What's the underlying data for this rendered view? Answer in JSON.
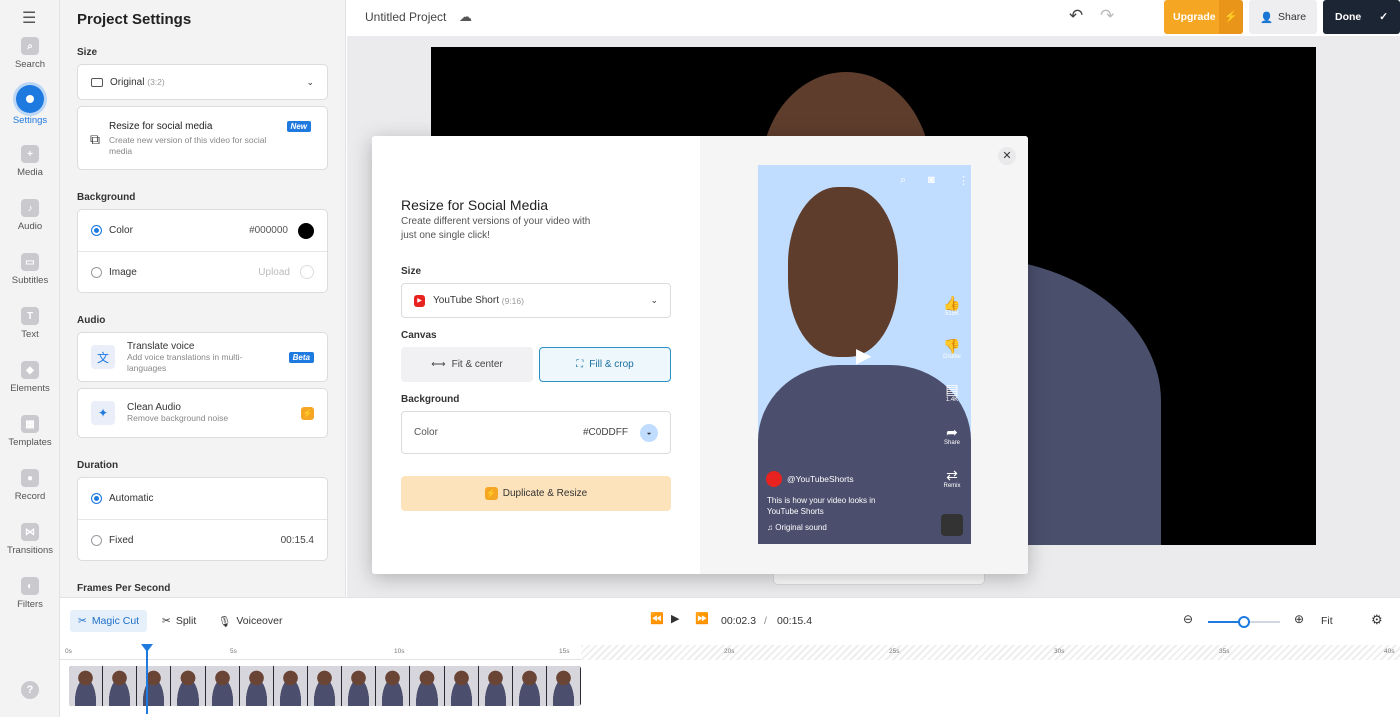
{
  "rail": {
    "items": [
      {
        "label": "Search",
        "icon": "search-icon"
      },
      {
        "label": "Settings",
        "icon": "settings-icon",
        "active": true
      },
      {
        "label": "Media",
        "icon": "media-icon"
      },
      {
        "label": "Audio",
        "icon": "audio-icon"
      },
      {
        "label": "Subtitles",
        "icon": "subtitles-icon"
      },
      {
        "label": "Text",
        "icon": "text-icon"
      },
      {
        "label": "Elements",
        "icon": "elements-icon"
      },
      {
        "label": "Templates",
        "icon": "templates-icon"
      },
      {
        "label": "Record",
        "icon": "record-icon"
      },
      {
        "label": "Transitions",
        "icon": "transitions-icon"
      },
      {
        "label": "Filters",
        "icon": "filters-icon"
      }
    ],
    "help": "?"
  },
  "settings": {
    "title": "Project Settings",
    "size": {
      "label": "Size",
      "value": "Original",
      "ratio": "(3:2)",
      "resize_title": "Resize for social media",
      "resize_desc": "Create new version of this video for social media",
      "resize_badge": "New"
    },
    "background": {
      "label": "Background",
      "color_label": "Color",
      "color_value": "#000000",
      "image_label": "Image",
      "upload_label": "Upload"
    },
    "audio": {
      "label": "Audio",
      "translate_title": "Translate voice",
      "translate_desc": "Add voice translations in multi-languages",
      "translate_badge": "Beta",
      "clean_title": "Clean Audio",
      "clean_desc": "Remove background noise"
    },
    "duration": {
      "label": "Duration",
      "automatic": "Automatic",
      "fixed": "Fixed",
      "fixed_value": "00:15.4"
    },
    "fps_label": "Frames Per Second"
  },
  "header": {
    "project_name": "Untitled Project",
    "upgrade": "Upgrade",
    "share": "Share",
    "done": "Done"
  },
  "modal": {
    "title": "Resize for Social Media",
    "subtitle": "Create different versions of your video with just one single click!",
    "size_label": "Size",
    "size_value": "YouTube Short",
    "size_ratio": "(9:16)",
    "canvas_label": "Canvas",
    "fit_label": "Fit & center",
    "fill_label": "Fill & crop",
    "background_label": "Background",
    "color_label": "Color",
    "color_value": "#C0DDFF",
    "duplicate_label": "Duplicate & Resize",
    "preview": {
      "likes": "515K",
      "dislike": "Dislike",
      "comments": "1.4K",
      "share": "Share",
      "remix": "Remix",
      "channel": "@YouTubeShorts",
      "caption": "This is how your video looks in YouTube Shorts",
      "sound": "Original sound"
    }
  },
  "timeline": {
    "magic_cut": "Magic Cut",
    "split": "Split",
    "voiceover": "Voiceover",
    "current_time": "00:02.3",
    "separator": "/",
    "total_time": "00:15.4",
    "fit": "Fit",
    "ticks": [
      "0s",
      "5s",
      "10s",
      "15s",
      "20s",
      "25s",
      "30s",
      "35s",
      "40s"
    ]
  },
  "colors": {
    "accent": "#1f7ae0",
    "upgrade": "#f5a623",
    "done_bg": "#1c2533",
    "preview_bg": "#C0DDFF",
    "duplicate_bg": "#fde3bb"
  }
}
